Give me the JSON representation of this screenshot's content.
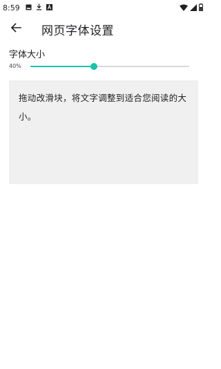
{
  "status_bar": {
    "time": "8:59",
    "left_icons": [
      "image-icon",
      "download-icon",
      "a-icon"
    ],
    "right_icons": [
      "wifi-icon",
      "signal-icon",
      "battery-icon"
    ]
  },
  "app_bar": {
    "back_icon": "arrow-left-icon",
    "title": "网页字体设置"
  },
  "font_size": {
    "label": "字体大小",
    "value_text": "40%",
    "value": 0.4,
    "accent_color": "#17c3aa"
  },
  "preview": {
    "text": "拖动改滑块，将文字调整到适合您阅读的大小。"
  }
}
